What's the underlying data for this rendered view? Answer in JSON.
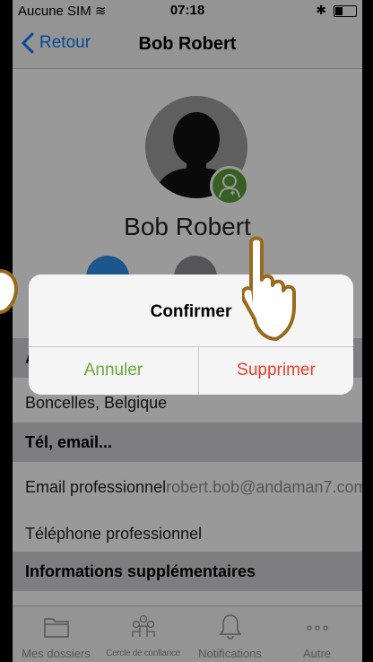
{
  "status_bar": {
    "carrier": "Aucune SIM",
    "time": "07:18"
  },
  "nav": {
    "back_label": "Retour",
    "title": "Bob Robert"
  },
  "profile": {
    "name": "Bob Robert"
  },
  "sections": [
    {
      "title": "Ad",
      "rows": [
        {
          "label": "Boncelles, Belgique"
        }
      ]
    },
    {
      "title": "Tél, email...",
      "rows": [
        {
          "label": "Email professionnel",
          "value": "robert.bob@andaman7.com"
        },
        {
          "label": "Téléphone professionnel"
        }
      ]
    },
    {
      "title": "Informations supplémentaires"
    }
  ],
  "dialog": {
    "title": "Confirmer",
    "cancel_label": "Annuler",
    "delete_label": "Supprimer"
  },
  "tabs": [
    {
      "label": "Mes dossiers",
      "icon": "folder-icon"
    },
    {
      "label": "Cercle de confiance",
      "icon": "people-circle-icon"
    },
    {
      "label": "Notifications",
      "icon": "bell-icon"
    },
    {
      "label": "Autre",
      "icon": "more-dots-icon"
    }
  ],
  "colors": {
    "ios_blue": "#0a7aff",
    "cancel_green": "#6aa83c",
    "delete_red": "#e8402c",
    "badge_green": "#5a9e3c",
    "hand_outline": "#9a6a1c"
  }
}
